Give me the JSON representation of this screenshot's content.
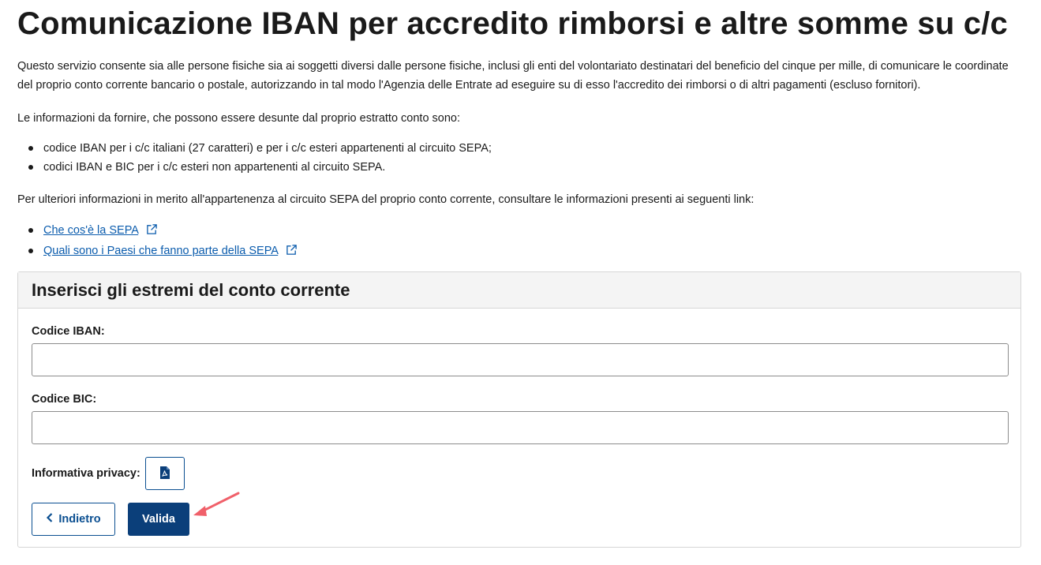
{
  "page": {
    "title": "Comunicazione IBAN per accredito rimborsi e altre somme su c/c",
    "intro": "Questo servizio consente sia alle persone fisiche sia ai soggetti diversi dalle persone fisiche, inclusi gli enti del volontariato destinatari del beneficio del cinque per mille, di comunicare le coordinate del proprio conto corrente bancario o postale, autorizzando in tal modo l'Agenzia delle Entrate ad eseguire su di esso l'accredito dei rimborsi o di altri pagamenti (escluso fornitori).",
    "info_intro": "Le informazioni da fornire, che possono essere desunte dal proprio estratto conto sono:",
    "bullets": [
      "codice IBAN per i c/c italiani (27 caratteri) e per i c/c esteri appartenenti al circuito SEPA;",
      "codici IBAN e BIC per i c/c esteri non appartenenti al circuito SEPA."
    ],
    "more_info": "Per ulteriori informazioni in merito all'appartenenza al circuito SEPA del proprio conto corrente, consultare le informazioni presenti ai seguenti link:",
    "links": [
      {
        "label": "Che cos'è la SEPA",
        "icon": "external-link-icon"
      },
      {
        "label": "Quali sono i Paesi che fanno parte della SEPA",
        "icon": "external-link-icon"
      }
    ]
  },
  "form": {
    "heading": "Inserisci gli estremi del conto corrente",
    "iban_label": "Codice IBAN:",
    "iban_value": "",
    "bic_label": "Codice BIC:",
    "bic_value": "",
    "privacy_label": "Informativa privacy:",
    "privacy_icon": "pdf-icon",
    "back_label": "Indietro",
    "back_icon": "chevron-left-icon",
    "submit_label": "Valida"
  },
  "colors": {
    "primary": "#0b3f7a",
    "link": "#0b5cad",
    "annotation_arrow": "#f0606a"
  }
}
